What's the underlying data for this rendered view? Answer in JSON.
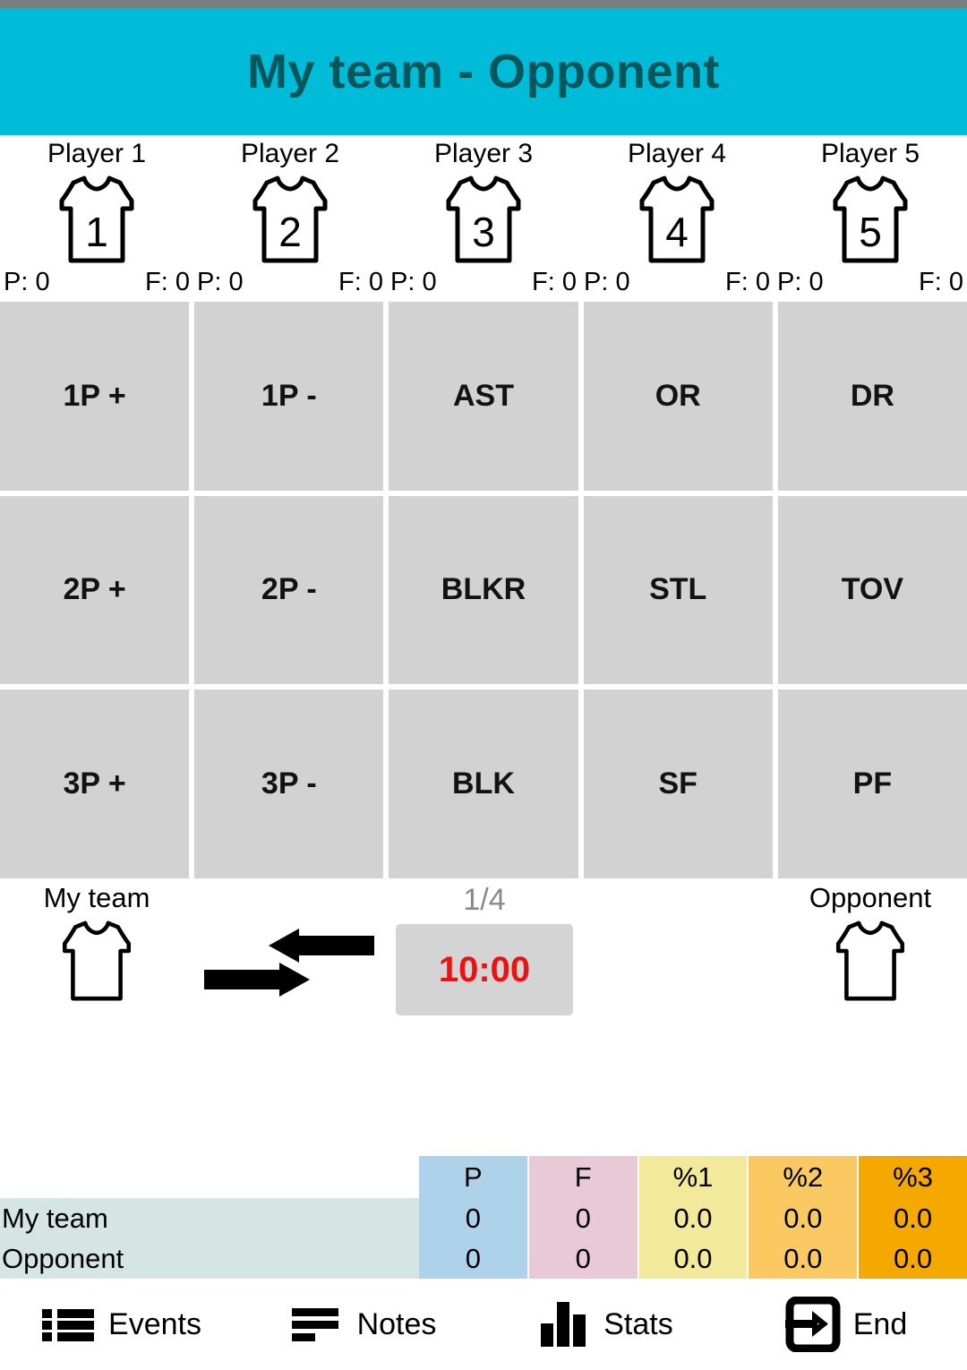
{
  "header": {
    "title": "My team - Opponent"
  },
  "players": [
    {
      "name": "Player 1",
      "number": "1",
      "points_label": "P: 0",
      "fouls_label": "F: 0"
    },
    {
      "name": "Player 2",
      "number": "2",
      "points_label": "P: 0",
      "fouls_label": "F: 0"
    },
    {
      "name": "Player 3",
      "number": "3",
      "points_label": "P: 0",
      "fouls_label": "F: 0"
    },
    {
      "name": "Player 4",
      "number": "4",
      "points_label": "P: 0",
      "fouls_label": "F: 0"
    },
    {
      "name": "Player 5",
      "number": "5",
      "points_label": "P: 0",
      "fouls_label": "F: 0"
    }
  ],
  "actions": [
    "1P +",
    "1P -",
    "AST",
    "OR",
    "DR",
    "2P +",
    "2P -",
    "BLKR",
    "STL",
    "TOV",
    "3P +",
    "3P -",
    "BLK",
    "SF",
    "PF"
  ],
  "mid": {
    "home_team": "My team",
    "away_team": "Opponent",
    "period": "1/4",
    "timer": "10:00",
    "timer_color": "#ee1111",
    "substitution_icon": "substitution-arrows-icon"
  },
  "scoreboard": {
    "columns": [
      {
        "key": "P",
        "label": "P",
        "color": "#aed2ea"
      },
      {
        "key": "F",
        "label": "F",
        "color": "#e9c9d6"
      },
      {
        "key": "%1",
        "label": "%1",
        "color": "#f2ea9a"
      },
      {
        "key": "%2",
        "label": "%2",
        "color": "#fac962"
      },
      {
        "key": "%3",
        "label": "%3",
        "color": "#f5a800"
      }
    ],
    "rows": [
      {
        "team": "My team",
        "values": [
          "0",
          "0",
          "0.0",
          "0.0",
          "0.0"
        ]
      },
      {
        "team": "Opponent",
        "values": [
          "0",
          "0",
          "0.0",
          "0.0",
          "0.0"
        ]
      }
    ],
    "name_bg": "#d5e5e2"
  },
  "bottom_nav": [
    {
      "label": "Events",
      "icon": "list-icon"
    },
    {
      "label": "Notes",
      "icon": "lines-icon"
    },
    {
      "label": "Stats",
      "icon": "bar-chart-icon"
    },
    {
      "label": "End",
      "icon": "exit-icon"
    }
  ],
  "colors": {
    "header_bg": "#00bcd8",
    "header_text": "#01585c",
    "status_bar": "#787d80",
    "action_button": "#d2d2d2",
    "timer_button": "#d4d4d4"
  }
}
